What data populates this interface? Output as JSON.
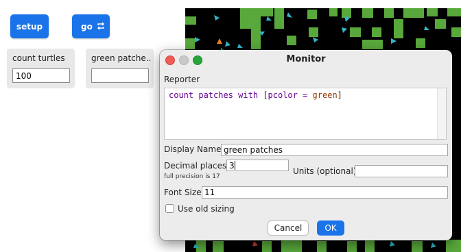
{
  "toolbar": {
    "setup_label": "setup",
    "go_label": "go"
  },
  "monitors": [
    {
      "label": "count turtles",
      "value": "100"
    },
    {
      "label": "green patche..",
      "value": ""
    }
  ],
  "dialog": {
    "title": "Monitor",
    "reporter_label": "Reporter",
    "reporter_code": {
      "t1": "count patches with",
      "t2": " [",
      "t3": "pcolor",
      "t4": " = ",
      "t5": "green",
      "t6": "]"
    },
    "display_name_label": "Display Name",
    "display_name_value": "green patches",
    "decimal_label": "Decimal places",
    "decimal_value": "3",
    "precision_note": "full precision is 17",
    "units_label": "Units (optional)",
    "units_value": "",
    "font_size_label": "Font Size",
    "font_size_value": "11",
    "old_sizing_label": "Use old sizing",
    "old_sizing_checked": false,
    "cancel_label": "Cancel",
    "ok_label": "OK"
  },
  "colors": {
    "accent": "#1a73e8",
    "patch_green": "#58a83b",
    "world_bg": "#000000"
  }
}
